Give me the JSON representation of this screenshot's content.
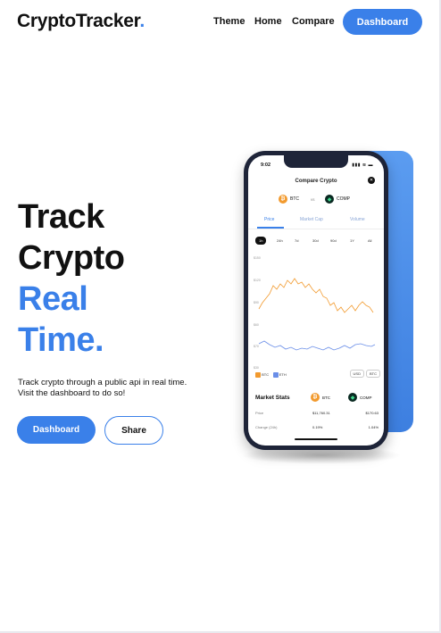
{
  "header": {
    "logo": "CryptoTracker",
    "logo_dot": ".",
    "nav": [
      "Theme",
      "Home",
      "Compare"
    ],
    "cta": "Dashboard"
  },
  "hero": {
    "line1": "Track",
    "line2": "Crypto",
    "line3": "Real",
    "line4": "Time.",
    "tagline": "Track crypto through a public api in real time. Visit the dashboard to do so!",
    "primary_button": "Dashboard",
    "secondary_button": "Share"
  },
  "colors": {
    "accent": "#3a80e9",
    "btc": "#f29a2e",
    "eth_line": "#6a8ee8"
  },
  "phone": {
    "time": "9:02",
    "status_icons": "▮▮▮ ≋ ▬",
    "title": "Compare Crypto",
    "coin_a": "BTC",
    "coin_b": "COMP",
    "vs": "vs",
    "tabs": [
      "Price",
      "Market Cap",
      "Volume"
    ],
    "periods": [
      "1h",
      "24h",
      "7d",
      "30d",
      "90d",
      "1Y",
      "All"
    ],
    "y_labels": [
      "$150",
      "$120",
      "$90",
      "$60",
      "$70",
      "$30"
    ],
    "legend": [
      "BTC",
      "ETH"
    ],
    "currency_toggle": [
      "USD",
      "BTC"
    ],
    "stats_title": "Market Stats",
    "stats_coin_a": "BTC",
    "stats_coin_b": "COMP",
    "stats_rows": [
      {
        "label": "Price",
        "a": "$11,760.31",
        "b": "$170.63"
      },
      {
        "label": "Change (24h)",
        "a": "0.19%",
        "b": "1.04%"
      }
    ]
  }
}
